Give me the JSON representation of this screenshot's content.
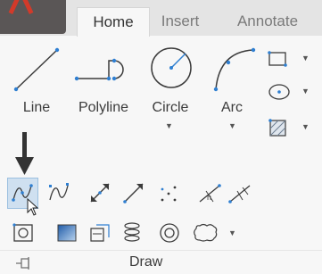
{
  "tabs": [
    {
      "label": "Home",
      "active": true
    },
    {
      "label": "Insert",
      "active": false
    },
    {
      "label": "Annotate",
      "active": false
    }
  ],
  "tools": {
    "line": "Line",
    "polyline": "Polyline",
    "circle": "Circle",
    "arc": "Arc"
  },
  "panel": {
    "title": "Draw"
  },
  "colors": {
    "accent": "#2f7fd1",
    "tab_bg": "#e4e4e4",
    "ribbon_bg": "#f7f7f7",
    "logo": "#5a5656"
  }
}
